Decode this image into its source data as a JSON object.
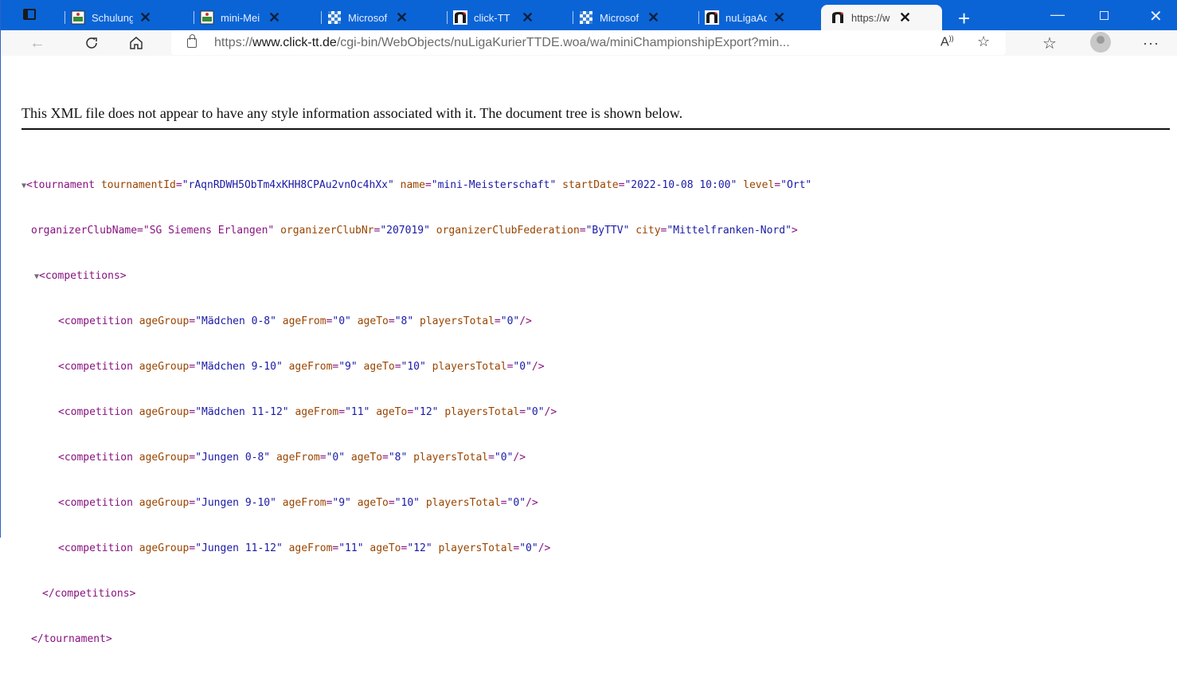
{
  "tabs": [
    {
      "label": "Schulung",
      "favicon": "tt-club-icon"
    },
    {
      "label": "mini-Mei",
      "favicon": "tt-club-icon"
    },
    {
      "label": "Microsof",
      "favicon": "bavaria-icon"
    },
    {
      "label": "click-TT",
      "favicon": "click-tt-icon"
    },
    {
      "label": "Microsof",
      "favicon": "bavaria-icon"
    },
    {
      "label": "nuLigaAd",
      "favicon": "click-tt-icon"
    },
    {
      "label": "https://w",
      "favicon": "click-tt-icon",
      "active": true
    }
  ],
  "address_bar": {
    "prefix": "https://",
    "domain": "www.click-tt.de",
    "path": "/cgi-bin/WebObjects/nuLigaKurierTTDE.woa/wa/miniChampionshipExport?min..."
  },
  "notice": "This XML file does not appear to have any style information associated with it. The document tree is shown below.",
  "xml": {
    "root_line1": "<tournament tournamentId=\"rAqnRDWH5ObTm4xKHH8CPAu2vnOc4hXx\" name=\"mini-Meisterschaft\" startDate=\"2022-10-08 10:00\" level=\"Ort\"",
    "root_line2": "organizerClubName=\"SG Siemens Erlangen\" organizerClubNr=\"207019\" organizerClubFederation=\"ByTTV\" city=\"Mittelfranken-Nord\">",
    "competitions_open": "<competitions>",
    "competitions": [
      "<competition ageGroup=\"Mädchen 0-8\" ageFrom=\"0\" ageTo=\"8\" playersTotal=\"0\"/>",
      "<competition ageGroup=\"Mädchen 9-10\" ageFrom=\"9\" ageTo=\"10\" playersTotal=\"0\"/>",
      "<competition ageGroup=\"Mädchen 11-12\" ageFrom=\"11\" ageTo=\"12\" playersTotal=\"0\"/>",
      "<competition ageGroup=\"Jungen 0-8\" ageFrom=\"0\" ageTo=\"8\" playersTotal=\"0\"/>",
      "<competition ageGroup=\"Jungen 9-10\" ageFrom=\"9\" ageTo=\"10\" playersTotal=\"0\"/>",
      "<competition ageGroup=\"Jungen 11-12\" ageFrom=\"11\" ageTo=\"12\" playersTotal=\"0\"/>"
    ],
    "competitions_close": "</competitions>",
    "root_close": "</tournament>"
  },
  "colors": {
    "titlebar": "#0a64d6",
    "tag": "#881280",
    "attr_name": "#994500",
    "attr_value": "#1a1aa6"
  }
}
